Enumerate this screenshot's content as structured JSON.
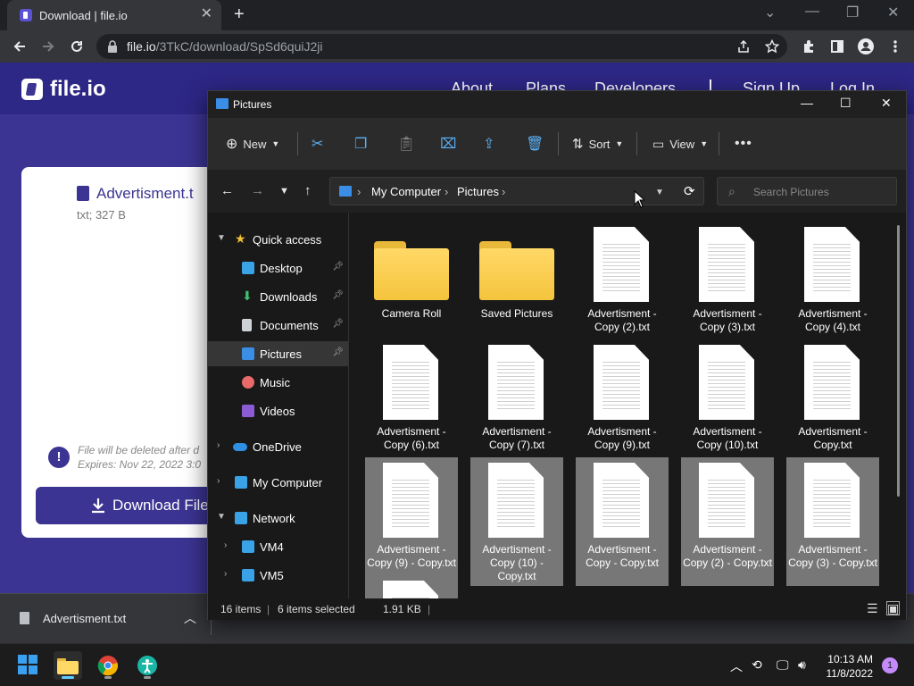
{
  "browser": {
    "tab_title": "Download | file.io",
    "url_host": "file.io",
    "url_path": "/3TkC/download/SpSd6quiJ2ji"
  },
  "site": {
    "logo_text": "file.io",
    "nav": [
      "About",
      "Plans",
      "Developers",
      "Sign Up",
      "Log In"
    ],
    "file_name": "Advertisment.t",
    "file_meta": "txt; 327 B",
    "info_line1": "File will be deleted after d",
    "info_line2": "Expires: Nov 22, 2022 3:0",
    "download_label": "Download File"
  },
  "shelf": {
    "file_name": "Advertisment.txt"
  },
  "explorer": {
    "title": "Pictures",
    "commands": {
      "new": "New",
      "sort": "Sort",
      "view": "View"
    },
    "breadcrumb": [
      "My Computer",
      "Pictures"
    ],
    "search_placeholder": "Search Pictures",
    "nav": {
      "quick_access": "Quick access",
      "desktop": "Desktop",
      "downloads": "Downloads",
      "documents": "Documents",
      "pictures": "Pictures",
      "music": "Music",
      "videos": "Videos",
      "onedrive": "OneDrive",
      "my_computer": "My Computer",
      "network": "Network",
      "vm4": "VM4",
      "vm5": "VM5"
    },
    "items": [
      {
        "label": "Camera Roll",
        "kind": "folder",
        "selected": false
      },
      {
        "label": "Saved Pictures",
        "kind": "folder",
        "selected": false
      },
      {
        "label": "Advertisment - Copy (2).txt",
        "kind": "file",
        "selected": false
      },
      {
        "label": "Advertisment - Copy (3).txt",
        "kind": "file",
        "selected": false
      },
      {
        "label": "Advertisment - Copy (4).txt",
        "kind": "file",
        "selected": false
      },
      {
        "label": "Advertisment - Copy (6).txt",
        "kind": "file",
        "selected": false
      },
      {
        "label": "Advertisment - Copy (7).txt",
        "kind": "file",
        "selected": false
      },
      {
        "label": "Advertisment - Copy (9).txt",
        "kind": "file",
        "selected": false
      },
      {
        "label": "Advertisment - Copy (10).txt",
        "kind": "file",
        "selected": false
      },
      {
        "label": "Advertisment - Copy.txt",
        "kind": "file",
        "selected": false
      },
      {
        "label": "Advertisment - Copy (9) - Copy.txt",
        "kind": "file",
        "selected": true
      },
      {
        "label": "Advertisment - Copy (10) - Copy.txt",
        "kind": "file",
        "selected": true
      },
      {
        "label": "Advertisment - Copy - Copy.txt",
        "kind": "file",
        "selected": true
      },
      {
        "label": "Advertisment - Copy (2) - Copy.txt",
        "kind": "file",
        "selected": true
      },
      {
        "label": "Advertisment - Copy (3) - Copy.txt",
        "kind": "file",
        "selected": true
      }
    ],
    "status": {
      "count": "16 items",
      "selected": "6 items selected",
      "size": "1.91 KB"
    }
  },
  "taskbar": {
    "time": "10:13 AM",
    "date": "11/8/2022",
    "notifications": "1"
  },
  "colors": {
    "site_bg": "#3b3492",
    "explorer_bg": "#191919",
    "accent": "#3a8ee6",
    "selection": "#777777"
  }
}
